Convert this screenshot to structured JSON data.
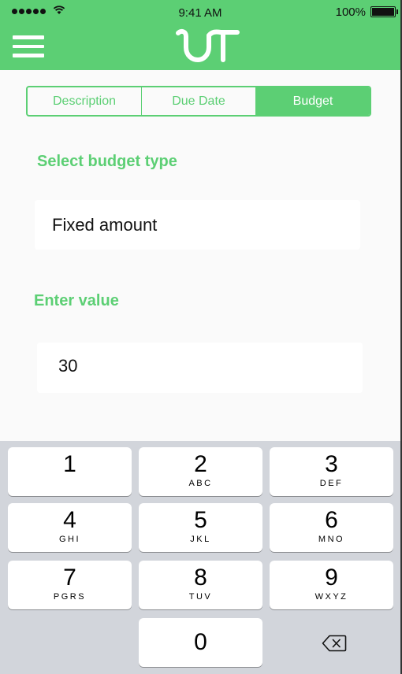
{
  "status": {
    "time": "9:41 AM",
    "battery": "100%"
  },
  "tabs": [
    "Description",
    "Due Date",
    "Budget"
  ],
  "active_tab": "Budget",
  "budget_type": {
    "label": "Select budget type",
    "value": "Fixed amount"
  },
  "value_input": {
    "label": "Enter value",
    "value": "30"
  },
  "keypad": [
    {
      "num": "1",
      "letters": ""
    },
    {
      "num": "2",
      "letters": "ABC"
    },
    {
      "num": "3",
      "letters": "DEF"
    },
    {
      "num": "4",
      "letters": "GHI"
    },
    {
      "num": "5",
      "letters": "JKL"
    },
    {
      "num": "6",
      "letters": "MNO"
    },
    {
      "num": "7",
      "letters": "PGRS"
    },
    {
      "num": "8",
      "letters": "TUV"
    },
    {
      "num": "9",
      "letters": "WXYZ"
    },
    {
      "num": "0",
      "letters": ""
    }
  ],
  "colors": {
    "brand": "#5ccf74",
    "keyboard_bg": "#d2d5db"
  },
  "icons": {
    "menu": "menu-icon",
    "logo": "ut-logo",
    "backspace": "backspace-icon",
    "wifi": "wifi-icon",
    "battery": "battery-icon"
  }
}
